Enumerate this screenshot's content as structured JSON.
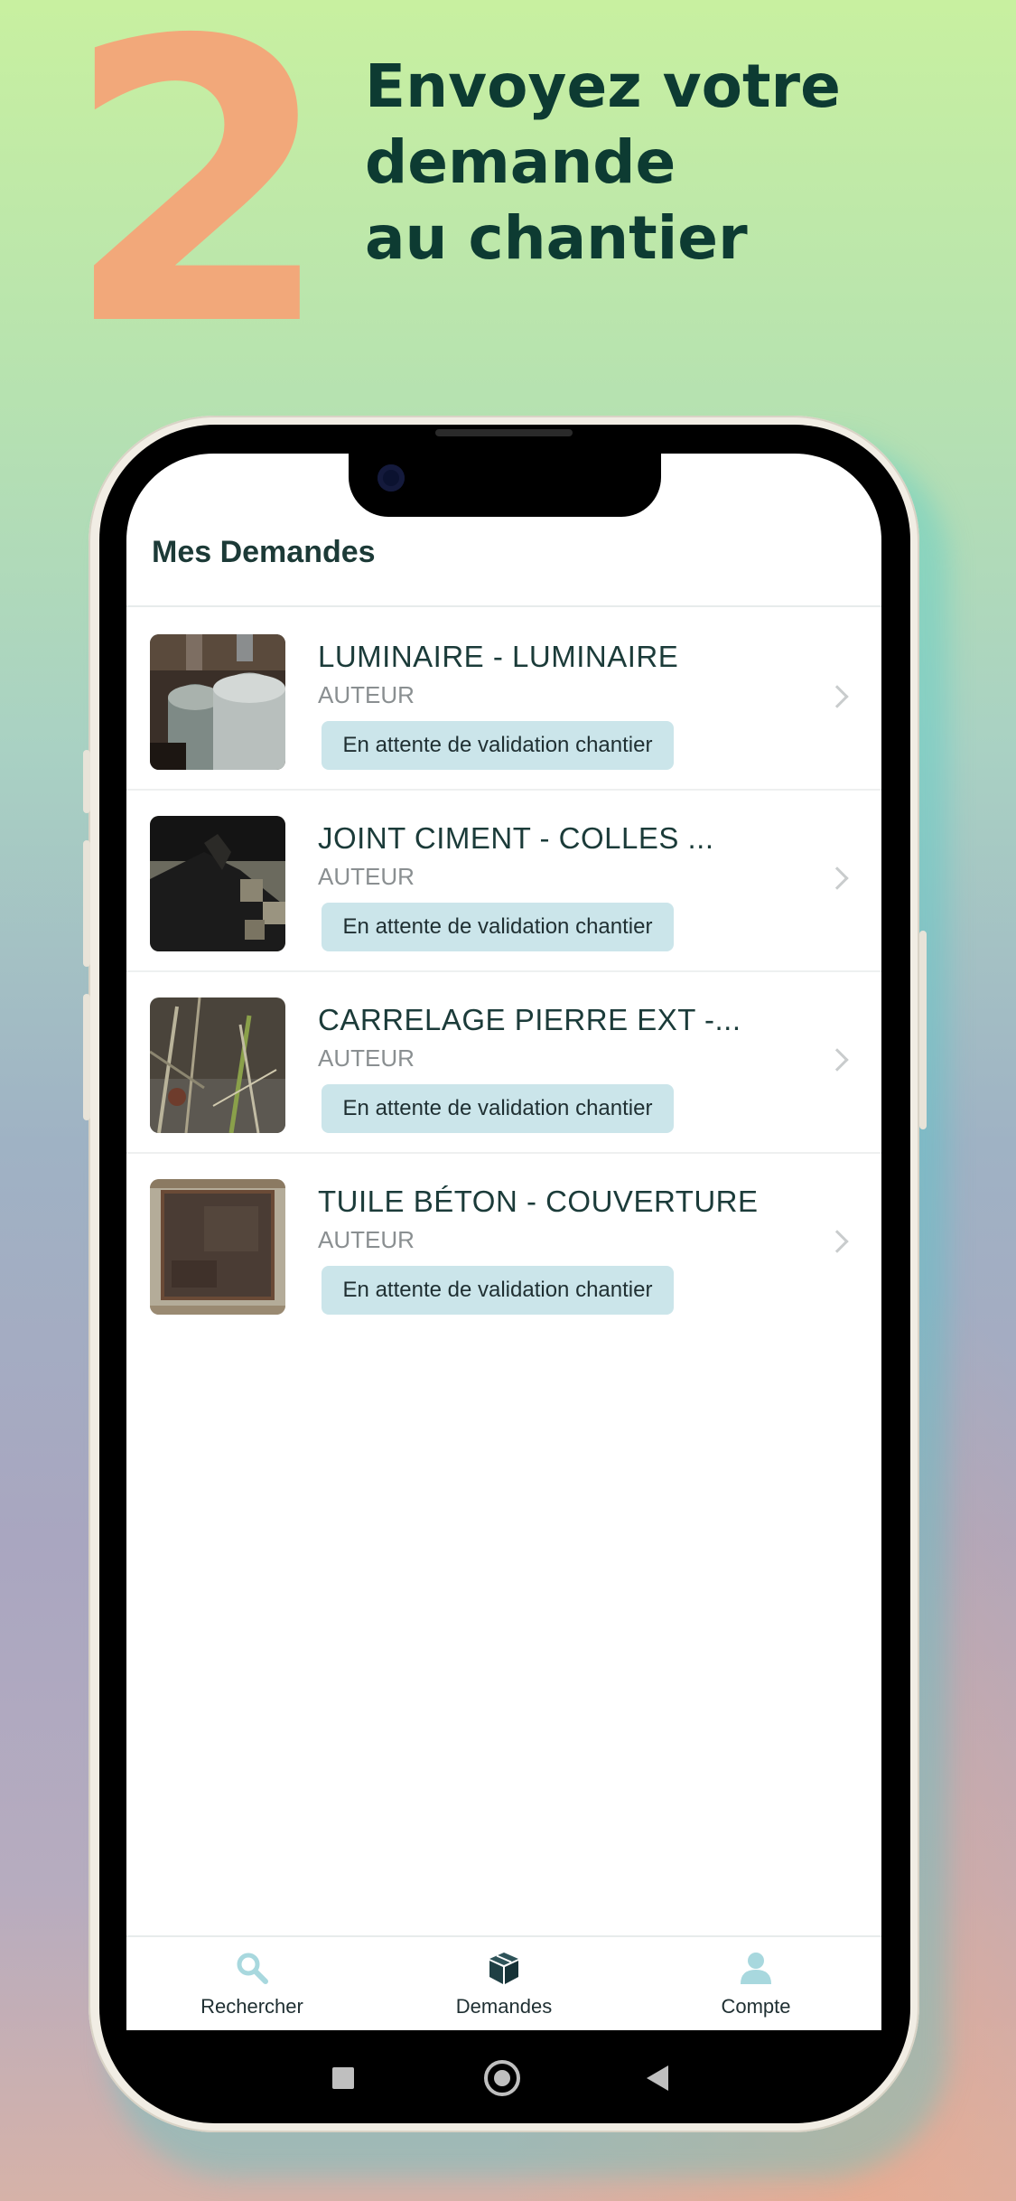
{
  "promo": {
    "step_number": "2",
    "headline_lines": [
      "Envoyez votre",
      "demande",
      "au chantier"
    ]
  },
  "app": {
    "title": "Mes Demandes",
    "requests": [
      {
        "title": "LUMINAIRE - LUMINAIRE",
        "subtitle": "AUTEUR",
        "status": "En attente de validation chantier",
        "image": "lamps-photo"
      },
      {
        "title": "JOINT CIMENT - COLLES ...",
        "subtitle": "AUTEUR",
        "status": "En attente de validation chantier",
        "image": "tile-floor-photo"
      },
      {
        "title": "CARRELAGE PIERRE EXT -...",
        "subtitle": "AUTEUR",
        "status": "En attente de validation chantier",
        "image": "vegetation-photo"
      },
      {
        "title": "TUILE BÉTON - COUVERTURE",
        "subtitle": "AUTEUR",
        "status": "En attente de validation chantier",
        "image": "concrete-tile-photo"
      }
    ],
    "tabbar": {
      "items": [
        {
          "label": "Rechercher",
          "icon": "search-icon",
          "active": false
        },
        {
          "label": "Demandes",
          "icon": "box-icon",
          "active": true
        },
        {
          "label": "Compte",
          "icon": "person-icon",
          "active": false
        }
      ]
    }
  },
  "colors": {
    "accent_orange": "#f2a87a",
    "headline": "#0d3b32",
    "badge_bg": "#cbe5ea",
    "inactive_icon": "#a8d8de",
    "active_icon": "#1f3f44"
  }
}
